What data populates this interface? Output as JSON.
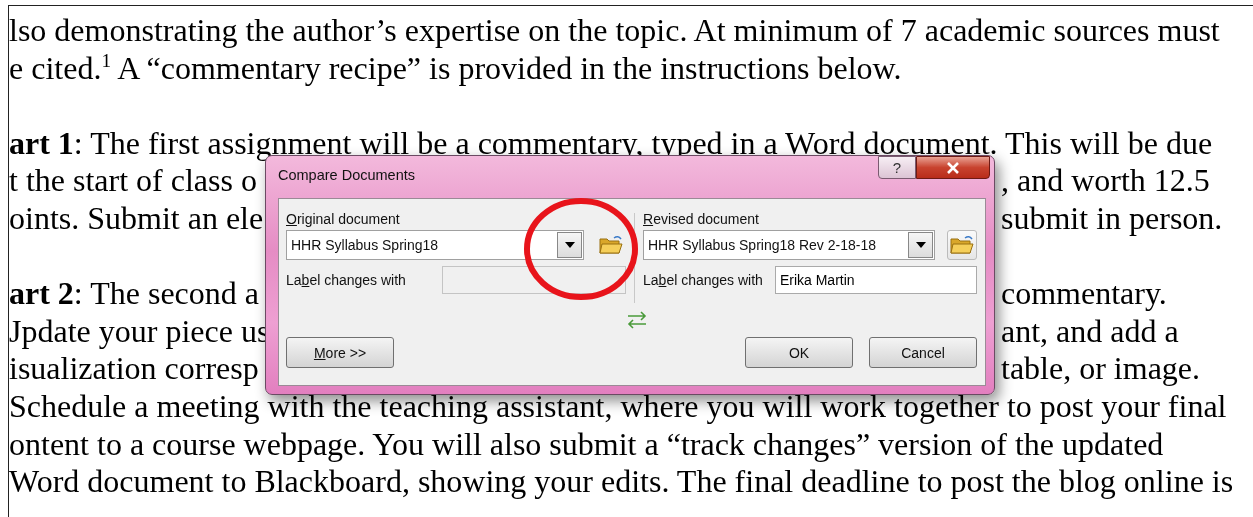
{
  "document": {
    "lines": [
      {
        "kind": "full",
        "text": "lso demonstrating the author’s expertise on the topic. At minimum of 7 academic sources must"
      },
      {
        "kind": "full",
        "text": "e cited.$^{1}$ A “commentary recipe” is provided in the instructions below."
      },
      {
        "kind": "blank"
      },
      {
        "kind": "full",
        "text": "**art 1**: The first assignment will be a commentary, typed in a Word document. This will be due"
      },
      {
        "kind": "split",
        "left": "t the start of class o",
        "right": ", and worth 12.5"
      },
      {
        "kind": "split",
        "left": "oints. Submit an ele",
        "right": "submit in person."
      },
      {
        "kind": "blank"
      },
      {
        "kind": "split",
        "left": "**art 2**: The second a",
        "right": "commentary."
      },
      {
        "kind": "split",
        "left": "Jpdate your piece us",
        "right": "ant, and add a"
      },
      {
        "kind": "split",
        "left": "isualization corresp",
        "right": "table, or image."
      },
      {
        "kind": "full",
        "text": "Schedule a meeting with the teaching assistant, where you will work together to post your final"
      },
      {
        "kind": "full",
        "text": "ontent to a course webpage. You will also submit a “track changes” version of the updated"
      },
      {
        "kind": "full",
        "text": "Word document to Blackboard, showing your edits. The final deadline to post the blog online is"
      }
    ]
  },
  "dialog": {
    "title": "Compare Documents",
    "help_button": "?",
    "original": {
      "heading": {
        "key": "O",
        "after": "riginal document"
      },
      "document": "HHR Syllabus Spring18",
      "label_caption": {
        "before": "La",
        "key": "b",
        "after": "el changes with"
      },
      "label_field": {
        "disabled": true
      }
    },
    "revised": {
      "heading": {
        "key": "R",
        "after": "evised document"
      },
      "document": "HHR Syllabus Spring18 Rev 2-18-18",
      "label_caption": {
        "before": "La",
        "key": "b",
        "after": "el changes with"
      },
      "label_field": {
        "disabled": false,
        "value": "Erika Martin"
      }
    },
    "buttons": [
      {
        "kind": "more",
        "label": {
          "key": "M",
          "after": "ore >>"
        }
      },
      {
        "kind": "ok",
        "label": {
          "before": "OK"
        }
      },
      {
        "kind": "cancel",
        "label": {
          "before": "Cancel"
        }
      }
    ]
  },
  "annotations": [
    {
      "kind": "ellipse"
    }
  ]
}
